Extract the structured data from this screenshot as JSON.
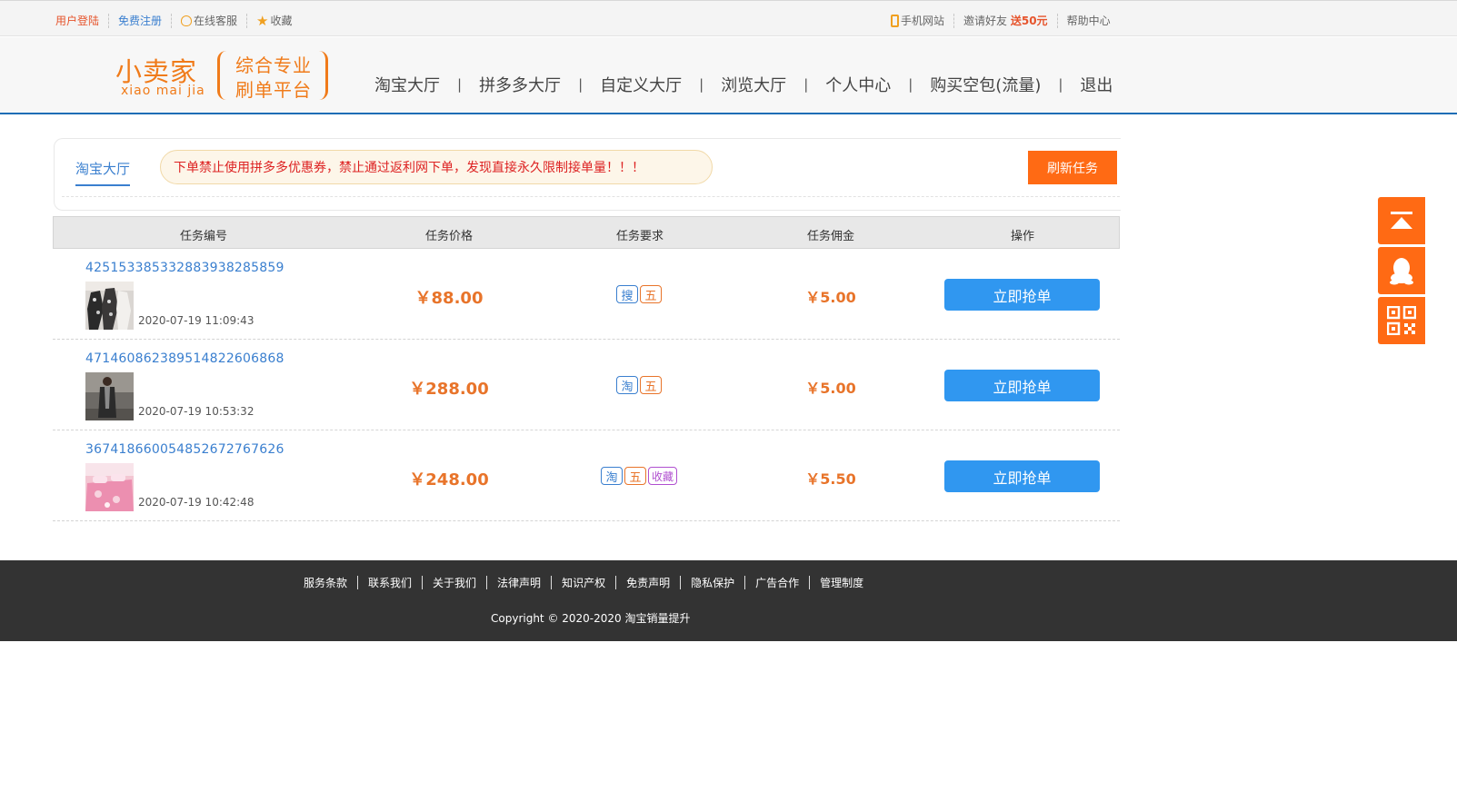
{
  "topbar": {
    "login": "用户登陆",
    "register": "免费注册",
    "service": "在线客服",
    "favorite": "收藏",
    "mobile": "手机网站",
    "invite": "邀请好友",
    "invite_bonus": "送50元",
    "help": "帮助中心"
  },
  "logo": {
    "name": "小卖家",
    "pinyin": "xiao mai jia",
    "slogan_1": "综合专业",
    "slogan_2": "刷单平台"
  },
  "nav": [
    "淘宝大厅",
    "拼多多大厅",
    "自定义大厅",
    "浏览大厅",
    "个人中心",
    "购买空包(流量)",
    "退出"
  ],
  "nav_separator": "|",
  "panel": {
    "tab": "淘宝大厅",
    "notice": "下单禁止使用拼多多优惠券，禁止通过返利网下单，发现直接永久限制接单量！！！",
    "refresh": "刷新任务"
  },
  "table": {
    "headers": [
      "任务编号",
      "任务价格",
      "任务要求",
      "任务佣金",
      "操作"
    ],
    "rows": [
      {
        "id": "4251533853328839382858 59",
        "id_full": "425153385332883938285859",
        "time": "2020-07-19 11:09:43",
        "price": "￥88.00",
        "reqs": [
          {
            "text": "搜",
            "type": "sou"
          },
          {
            "text": "五",
            "type": "wu"
          }
        ],
        "commission": "￥5.00",
        "action": "立即抢单"
      },
      {
        "id_full": "471460862389514822606868",
        "time": "2020-07-19 10:53:32",
        "price": "￥288.00",
        "reqs": [
          {
            "text": "淘",
            "type": "tao"
          },
          {
            "text": "五",
            "type": "wu"
          }
        ],
        "commission": "￥5.00",
        "action": "立即抢单"
      },
      {
        "id_full": "367418660054852672767626",
        "time": "2020-07-19 10:42:48",
        "price": "￥248.00",
        "reqs": [
          {
            "text": "淘",
            "type": "tao"
          },
          {
            "text": "五",
            "type": "wu"
          },
          {
            "text": "收藏",
            "type": "fav"
          }
        ],
        "commission": "￥5.50",
        "action": "立即抢单"
      }
    ]
  },
  "footer": {
    "links": [
      "服务条款",
      "联系我们",
      "关于我们",
      "法律声明",
      "知识产权",
      "免责声明",
      "隐私保护",
      "广告合作",
      "管理制度"
    ],
    "copyright": "Copyright © 2020-2020 淘宝销量提升"
  },
  "side_buttons": [
    "back-to-top-icon",
    "qq-icon",
    "qr-code-icon"
  ],
  "colors": {
    "accent_orange": "#ff6a14",
    "brand_orange": "#f07b1a",
    "link_blue": "#3a7fcf",
    "button_blue": "#3097f0",
    "header_rule": "#1e6db5"
  }
}
